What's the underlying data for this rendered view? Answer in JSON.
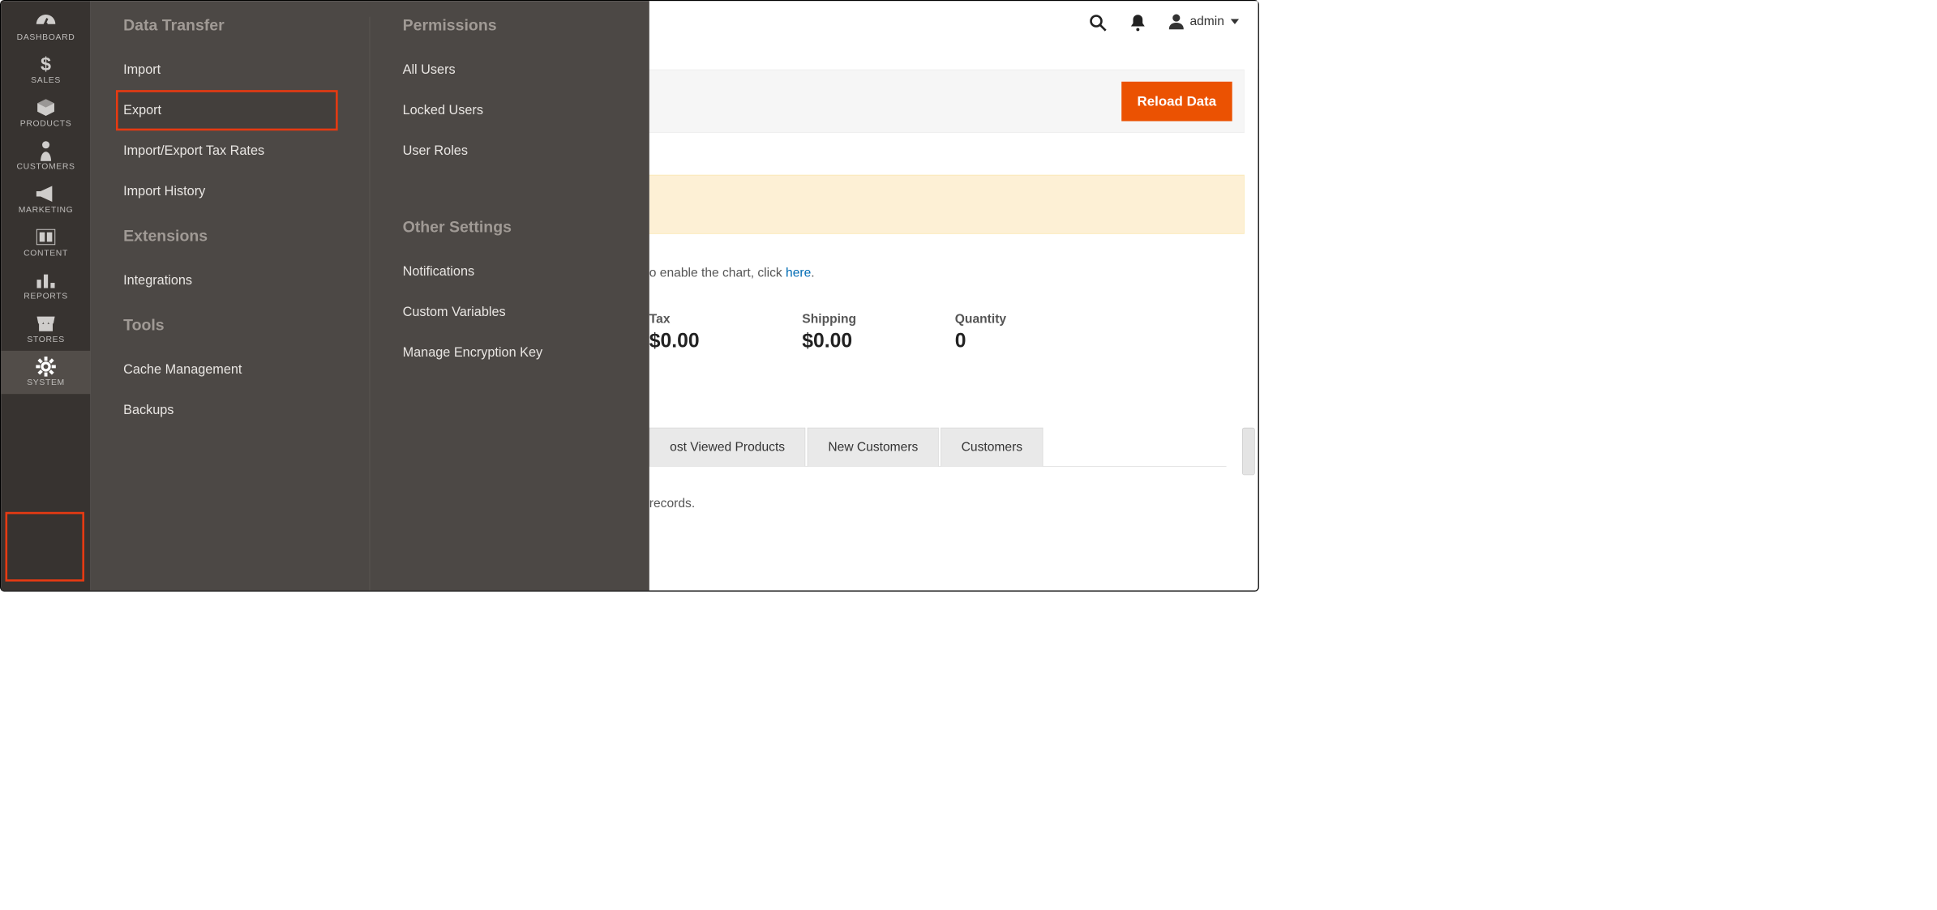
{
  "rail": {
    "items": [
      {
        "id": "dashboard",
        "label": "DASHBOARD",
        "icon": "gauge"
      },
      {
        "id": "sales",
        "label": "SALES",
        "icon": "dollar"
      },
      {
        "id": "products",
        "label": "PRODUCTS",
        "icon": "box"
      },
      {
        "id": "customers",
        "label": "CUSTOMERS",
        "icon": "person"
      },
      {
        "id": "marketing",
        "label": "MARKETING",
        "icon": "megaphone"
      },
      {
        "id": "content",
        "label": "CONTENT",
        "icon": "layout"
      },
      {
        "id": "reports",
        "label": "REPORTS",
        "icon": "bars"
      },
      {
        "id": "stores",
        "label": "STORES",
        "icon": "storefront"
      },
      {
        "id": "system",
        "label": "SYSTEM",
        "icon": "gear",
        "active": true
      }
    ]
  },
  "flyout": {
    "col1": [
      {
        "heading": "Data Transfer"
      },
      {
        "link": "Import"
      },
      {
        "link": "Export",
        "highlighted": true
      },
      {
        "link": "Import/Export Tax Rates"
      },
      {
        "link": "Import History"
      },
      {
        "heading": "Extensions"
      },
      {
        "link": "Integrations"
      },
      {
        "heading": "Tools"
      },
      {
        "link": "Cache Management"
      },
      {
        "link": "Backups"
      }
    ],
    "col2": [
      {
        "heading": "Permissions"
      },
      {
        "link": "All Users"
      },
      {
        "link": "Locked Users"
      },
      {
        "link": "User Roles"
      },
      {
        "heading": "Other Settings"
      },
      {
        "link": "Notifications"
      },
      {
        "link": "Custom Variables"
      },
      {
        "link": "Manage Encryption Key"
      }
    ]
  },
  "header": {
    "user_label": "admin"
  },
  "actionbar": {
    "reload_label": "Reload Data"
  },
  "chartline": {
    "prefix": "o enable the chart, click ",
    "link": "here",
    "suffix": "."
  },
  "stats": [
    {
      "label": "Tax",
      "value": "$0.00"
    },
    {
      "label": "Shipping",
      "value": "$0.00"
    },
    {
      "label": "Quantity",
      "value": "0"
    }
  ],
  "tabs": [
    "ost Viewed Products",
    "New Customers",
    "Customers"
  ],
  "records_line": "records."
}
